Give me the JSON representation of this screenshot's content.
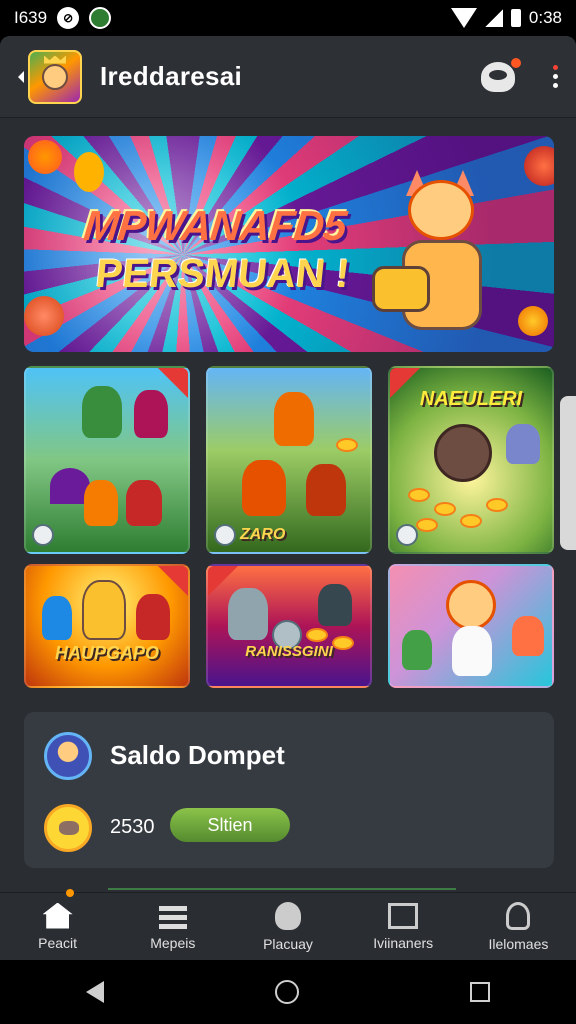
{
  "status_bar": {
    "time_left": "I639",
    "time_right": "0:38"
  },
  "app_bar": {
    "title": "Ireddaresai"
  },
  "banner": {
    "headline": "MPWANAFD5",
    "subheadline": "PERSMUAN !"
  },
  "games": [
    {
      "label": ""
    },
    {
      "label": "ZARO"
    },
    {
      "label": "NAEULERI"
    },
    {
      "label": "HAUPGAPO"
    },
    {
      "label": "RANISSGINI"
    },
    {
      "label": ""
    }
  ],
  "wallet": {
    "title": "Saldo Dompet",
    "amount": "2530",
    "button_label": "Sltien"
  },
  "bottom_nav": [
    {
      "label": "Peacit",
      "icon": "home-icon"
    },
    {
      "label": "Mepeis",
      "icon": "grid-icon"
    },
    {
      "label": "Placuay",
      "icon": "badge-icon"
    },
    {
      "label": "Iviinaners",
      "icon": "frame-icon"
    },
    {
      "label": "Ilelomaes",
      "icon": "user-icon"
    }
  ],
  "colors": {
    "background": "#2a2d32",
    "card": "#363a41",
    "accent_green": "#8bc34a",
    "banner_text": "#ffd54f"
  }
}
